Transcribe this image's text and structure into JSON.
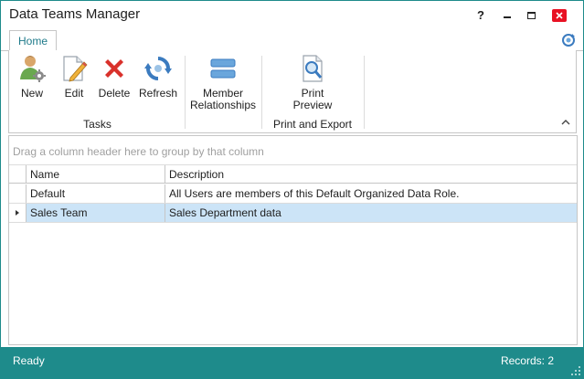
{
  "window": {
    "title": "Data Teams Manager",
    "help_glyph": "?",
    "minimize_icon": "minimize-icon",
    "maximize_icon": "maximize-icon",
    "close_icon": "close-icon"
  },
  "ribbon": {
    "tabs": [
      {
        "label": "Home",
        "active": true
      }
    ],
    "groups": [
      {
        "label": "Tasks",
        "buttons": [
          {
            "label": "New",
            "icon": "new-user-icon"
          },
          {
            "label": "Edit",
            "icon": "edit-icon"
          },
          {
            "label": "Delete",
            "icon": "delete-icon"
          },
          {
            "label": "Refresh",
            "icon": "refresh-icon"
          }
        ]
      },
      {
        "label": "",
        "buttons": [
          {
            "label": "Member\nRelationships",
            "icon": "relationships-icon"
          }
        ]
      },
      {
        "label": "Print and Export",
        "buttons": [
          {
            "label": "Print\nPreview",
            "icon": "print-preview-icon"
          }
        ]
      }
    ]
  },
  "grid": {
    "group_panel_text": "Drag a column header here to group by that column",
    "columns": [
      "Name",
      "Description"
    ],
    "rows": [
      {
        "name": "Default",
        "description": "All Users are members of this Default Organized Data Role.",
        "selected": false
      },
      {
        "name": "Sales Team",
        "description": "Sales Department data",
        "selected": true
      }
    ]
  },
  "status": {
    "left": "Ready",
    "right": "Records: 2"
  },
  "colors": {
    "accent": "#1e8b8b",
    "selection": "#cce4f7",
    "close_red": "#e81123",
    "tab_text": "#1e7a8a"
  }
}
